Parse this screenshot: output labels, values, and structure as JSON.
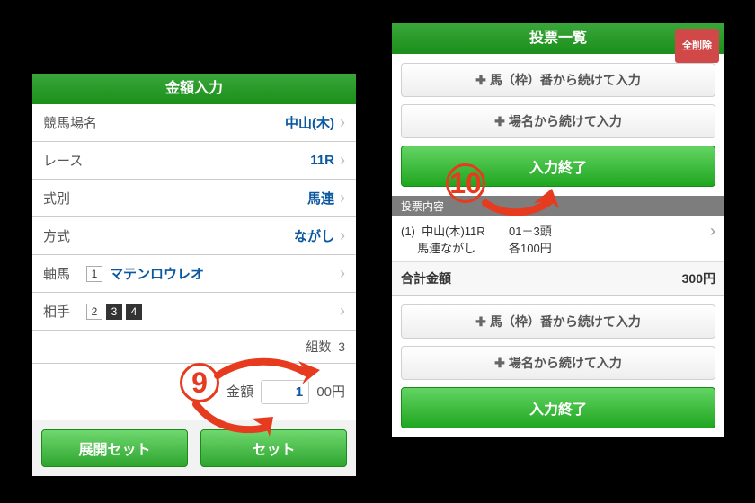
{
  "left": {
    "title": "金額入力",
    "rows": [
      {
        "label": "競馬場名",
        "value": "中山(木)"
      },
      {
        "label": "レース",
        "value": "11R"
      },
      {
        "label": "式別",
        "value": "馬連"
      },
      {
        "label": "方式",
        "value": "ながし"
      }
    ],
    "axis": {
      "label": "軸馬",
      "num": "1",
      "name": "マテンロウレオ"
    },
    "opponent": {
      "label": "相手",
      "nums": [
        "2",
        "3",
        "4"
      ]
    },
    "kumi": {
      "label": "組数",
      "value": "3"
    },
    "amount": {
      "label": "金額",
      "value": "1",
      "suffix": "00円"
    },
    "buttons": {
      "expand": "展開セット",
      "set": "セット"
    }
  },
  "right": {
    "title": "投票一覧",
    "delete_all": "全削除",
    "btn_horse": "馬（枠）番から続けて入力",
    "btn_name": "場名から続けて入力",
    "btn_done": "入力終了",
    "subhead": "投票内容",
    "bet": {
      "idx": "(1)",
      "line1": "中山(木)11R",
      "line2": "馬連ながし",
      "col2a": "01－3頭",
      "col2b": "各100円"
    },
    "total": {
      "label": "合計金額",
      "value": "300円"
    }
  },
  "callouts": {
    "left": "9",
    "right": "10"
  }
}
